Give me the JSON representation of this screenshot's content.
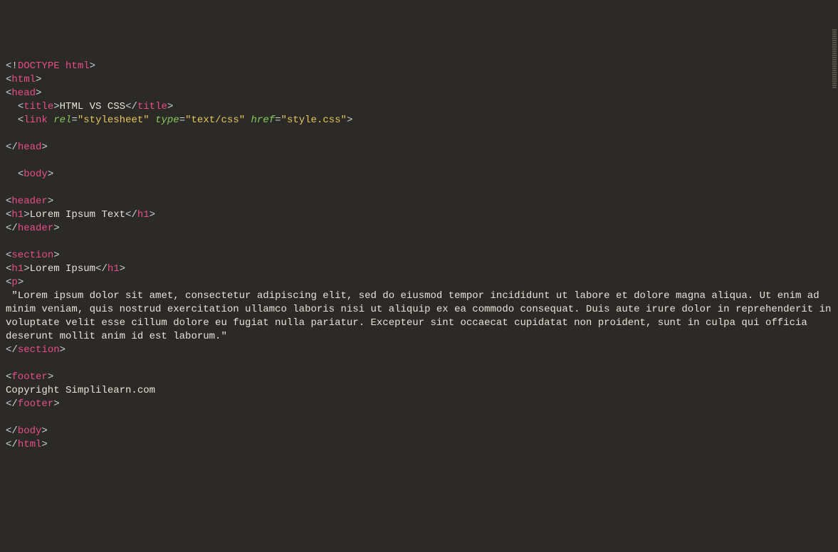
{
  "code": {
    "doctype": "DOCTYPE html",
    "tag_html": "html",
    "tag_head": "head",
    "tag_title": "title",
    "title_text": "HTML VS CSS",
    "tag_link": "link",
    "attr_rel": "rel",
    "val_rel": "\"stylesheet\"",
    "attr_type": "type",
    "val_type": "\"text/css\"",
    "attr_href": "href",
    "val_href": "\"style.css\"",
    "tag_body": "body",
    "tag_header": "header",
    "tag_h1": "h1",
    "h1_header_text": "Lorem Ipsum Text",
    "tag_section": "section",
    "h1_section_text": "Lorem Ipsum",
    "tag_p": "p",
    "paragraph_text": " \"Lorem ipsum dolor sit amet, consectetur adipiscing elit, sed do eiusmod tempor incididunt ut labore et dolore magna aliqua. Ut enim ad minim veniam, quis nostrud exercitation ullamco laboris nisi ut aliquip ex ea commodo consequat. Duis aute irure dolor in reprehenderit in voluptate velit esse cillum dolore eu fugiat nulla pariatur. Excepteur sint occaecat cupidatat non proident, sunt in culpa qui officia deserunt mollit anim id est laborum.\"",
    "tag_footer": "footer",
    "footer_text": "Copyright Simplilearn.com"
  }
}
